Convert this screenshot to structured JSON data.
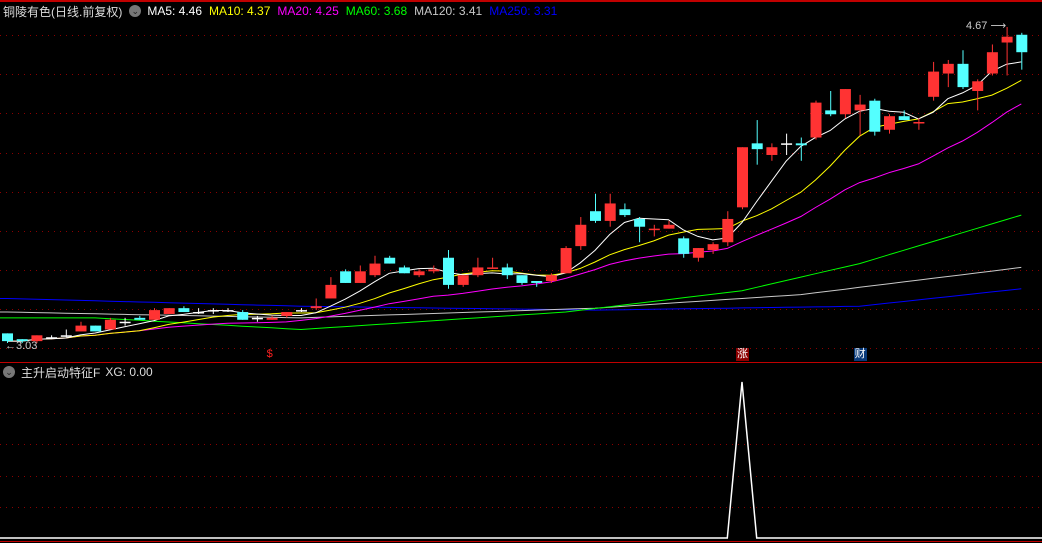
{
  "header": {
    "title": "铜陵有色(日线.前复权)",
    "ma5": "MA5: 4.46",
    "ma10": "MA10: 4.37",
    "ma20": "MA20: 4.25",
    "ma60": "MA60: 3.68",
    "ma120": "MA120: 3.41",
    "ma250": "MA250: 3.31"
  },
  "indicator_header": {
    "name": "主升启动特征F",
    "xg": "XG: 0.00"
  },
  "price_labels": {
    "high": "4.67",
    "low": "3.03"
  },
  "markers": [
    {
      "index": 18,
      "text": "$",
      "color": "#ff2020",
      "bg": "transparent"
    },
    {
      "index": 50,
      "text": "涨",
      "color": "#ffffff",
      "bg": "#8b0000"
    },
    {
      "index": 58,
      "text": "财",
      "color": "#ffffff",
      "bg": "#0a3a7a"
    }
  ],
  "colors": {
    "up": "#ff3333",
    "down": "#54ffff",
    "flat": "#ffffff",
    "ma5": "#ffffff",
    "ma10": "#ffff00",
    "ma20": "#ff00ff",
    "ma60": "#00ff00",
    "ma120": "#c8c8c8",
    "ma250": "#0000ff",
    "grid": "#8b0000"
  },
  "chart_data": {
    "type": "candlestick",
    "title": "铜陵有色(日线.前复权)",
    "ylim": [
      3.03,
      4.67
    ],
    "ohlc": [
      [
        3.09,
        3.09,
        3.04,
        3.05
      ],
      [
        3.06,
        3.06,
        3.04,
        3.05
      ],
      [
        3.05,
        3.08,
        3.04,
        3.08
      ],
      [
        3.07,
        3.08,
        3.06,
        3.07
      ],
      [
        3.08,
        3.11,
        3.07,
        3.08
      ],
      [
        3.1,
        3.15,
        3.1,
        3.13
      ],
      [
        3.13,
        3.13,
        3.1,
        3.1
      ],
      [
        3.11,
        3.17,
        3.11,
        3.16
      ],
      [
        3.15,
        3.17,
        3.13,
        3.15
      ],
      [
        3.17,
        3.18,
        3.16,
        3.16
      ],
      [
        3.16,
        3.22,
        3.16,
        3.21
      ],
      [
        3.19,
        3.22,
        3.19,
        3.22
      ],
      [
        3.22,
        3.23,
        3.2,
        3.2
      ],
      [
        3.2,
        3.22,
        3.19,
        3.2
      ],
      [
        3.21,
        3.22,
        3.19,
        3.21
      ],
      [
        3.21,
        3.22,
        3.2,
        3.21
      ],
      [
        3.2,
        3.21,
        3.16,
        3.16
      ],
      [
        3.17,
        3.18,
        3.15,
        3.17
      ],
      [
        3.16,
        3.18,
        3.16,
        3.17
      ],
      [
        3.18,
        3.2,
        3.17,
        3.2
      ],
      [
        3.21,
        3.22,
        3.2,
        3.21
      ],
      [
        3.22,
        3.27,
        3.21,
        3.23
      ],
      [
        3.27,
        3.38,
        3.27,
        3.34
      ],
      [
        3.41,
        3.42,
        3.35,
        3.35
      ],
      [
        3.35,
        3.44,
        3.35,
        3.41
      ],
      [
        3.39,
        3.49,
        3.38,
        3.45
      ],
      [
        3.48,
        3.49,
        3.45,
        3.45
      ],
      [
        3.43,
        3.44,
        3.4,
        3.4
      ],
      [
        3.39,
        3.42,
        3.38,
        3.41
      ],
      [
        3.41,
        3.44,
        3.4,
        3.42
      ],
      [
        3.48,
        3.52,
        3.32,
        3.34
      ],
      [
        3.34,
        3.39,
        3.33,
        3.39
      ],
      [
        3.39,
        3.48,
        3.38,
        3.43
      ],
      [
        3.43,
        3.48,
        3.43,
        3.43
      ],
      [
        3.43,
        3.45,
        3.37,
        3.39
      ],
      [
        3.39,
        3.39,
        3.34,
        3.35
      ],
      [
        3.36,
        3.36,
        3.33,
        3.35
      ],
      [
        3.36,
        3.4,
        3.35,
        3.39
      ],
      [
        3.4,
        3.54,
        3.4,
        3.53
      ],
      [
        3.54,
        3.69,
        3.52,
        3.65
      ],
      [
        3.72,
        3.81,
        3.66,
        3.67
      ],
      [
        3.67,
        3.81,
        3.64,
        3.76
      ],
      [
        3.73,
        3.76,
        3.69,
        3.7
      ],
      [
        3.68,
        3.69,
        3.56,
        3.64
      ],
      [
        3.63,
        3.65,
        3.59,
        3.63
      ],
      [
        3.63,
        3.67,
        3.63,
        3.65
      ],
      [
        3.58,
        3.59,
        3.48,
        3.5
      ],
      [
        3.48,
        3.53,
        3.46,
        3.53
      ],
      [
        3.52,
        3.56,
        3.5,
        3.55
      ],
      [
        3.56,
        3.72,
        3.54,
        3.68
      ],
      [
        3.74,
        4.05,
        3.73,
        4.05
      ],
      [
        4.07,
        4.19,
        3.96,
        4.04
      ],
      [
        4.01,
        4.07,
        3.98,
        4.05
      ],
      [
        4.07,
        4.12,
        4.01,
        4.07
      ],
      [
        4.07,
        4.1,
        3.98,
        4.06
      ],
      [
        4.1,
        4.29,
        4.09,
        4.28
      ],
      [
        4.24,
        4.34,
        4.21,
        4.22
      ],
      [
        4.22,
        4.35,
        4.2,
        4.35
      ],
      [
        4.24,
        4.32,
        4.11,
        4.27
      ],
      [
        4.29,
        4.3,
        4.11,
        4.13
      ],
      [
        4.14,
        4.22,
        4.12,
        4.21
      ],
      [
        4.21,
        4.24,
        4.19,
        4.19
      ],
      [
        4.18,
        4.2,
        4.14,
        4.18
      ],
      [
        4.31,
        4.49,
        4.29,
        4.44
      ],
      [
        4.43,
        4.5,
        4.36,
        4.48
      ],
      [
        4.48,
        4.55,
        4.35,
        4.36
      ],
      [
        4.34,
        4.4,
        4.24,
        4.39
      ],
      [
        4.43,
        4.58,
        4.42,
        4.54
      ],
      [
        4.59,
        4.67,
        4.42,
        4.62
      ],
      [
        4.63,
        4.64,
        4.45,
        4.54
      ]
    ],
    "long_ma": {
      "ma60": {
        "index": [
          0,
          6,
          20,
          38,
          50,
          58,
          69
        ],
        "value": [
          3.17,
          3.17,
          3.11,
          3.2,
          3.31,
          3.45,
          3.7
        ]
      },
      "ma120": {
        "index": [
          0,
          20,
          40,
          54,
          69
        ],
        "value": [
          3.2,
          3.17,
          3.22,
          3.29,
          3.43
        ]
      },
      "ma250": {
        "index": [
          0,
          20,
          40,
          58,
          69
        ],
        "value": [
          3.27,
          3.23,
          3.21,
          3.23,
          3.32
        ]
      }
    },
    "indicator": {
      "name": "XG",
      "ylim": [
        0,
        1
      ],
      "values_nonzero": {
        "50": 1
      }
    }
  }
}
